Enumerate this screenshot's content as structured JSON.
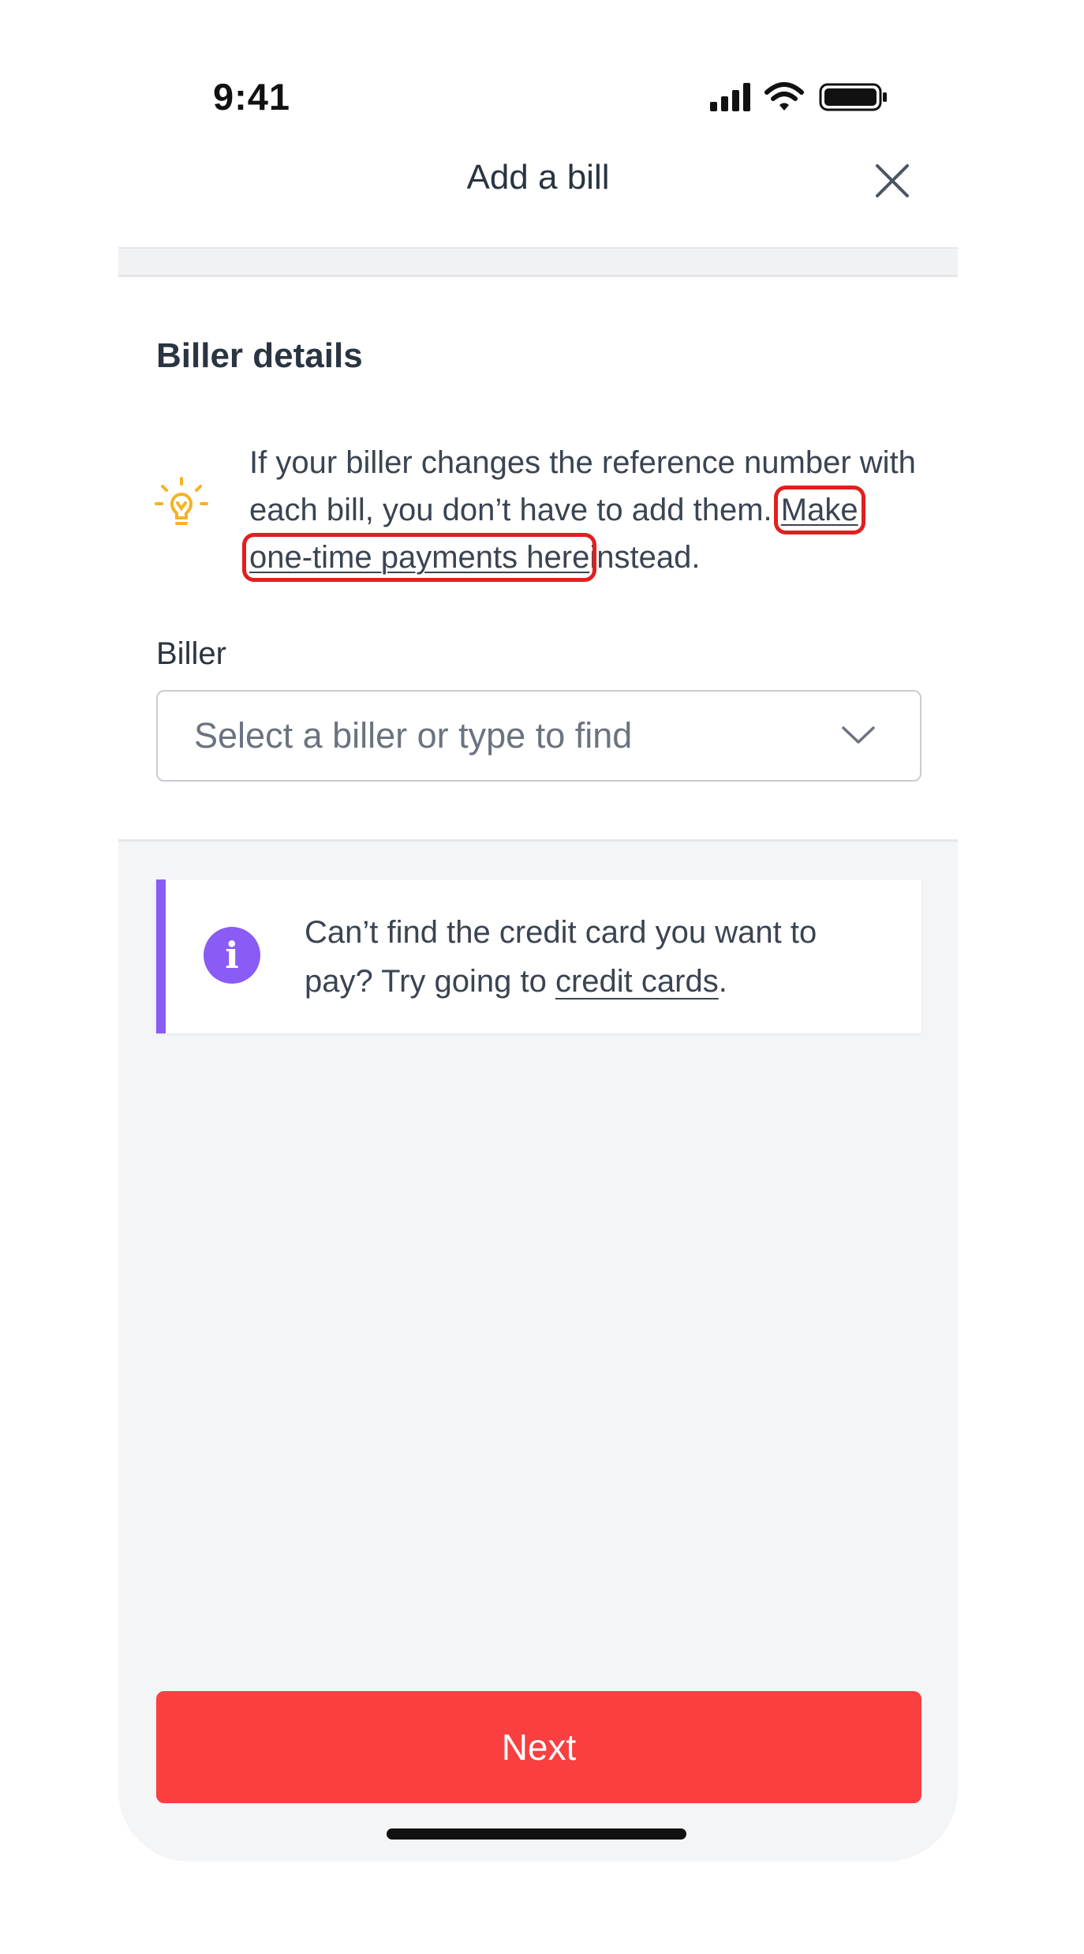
{
  "status_bar": {
    "time": "9:41"
  },
  "header": {
    "title": "Add a bill",
    "close_icon": "close-icon"
  },
  "biller_section": {
    "title": "Biller details",
    "tip": {
      "icon": "lightbulb-icon",
      "icon_color": "#f5b324",
      "text_before": "If your biller changes the reference number with each bill, you don’t have to add them.",
      "link_text": "Make one-time payments here",
      "text_after": "instead.",
      "highlight_color": "#e41e1e"
    },
    "biller_field": {
      "label": "Biller",
      "placeholder": "Select a biller or type to find",
      "icon": "chevron-down-icon"
    }
  },
  "info_banner": {
    "icon": "info-icon",
    "accent_color": "#8a5cf5",
    "text_before": "Can’t find the credit card you want to pay? Try going to",
    "link_text": "credit cards",
    "text_after": "."
  },
  "next_button": {
    "label": "Next",
    "color": "#f93f40"
  }
}
